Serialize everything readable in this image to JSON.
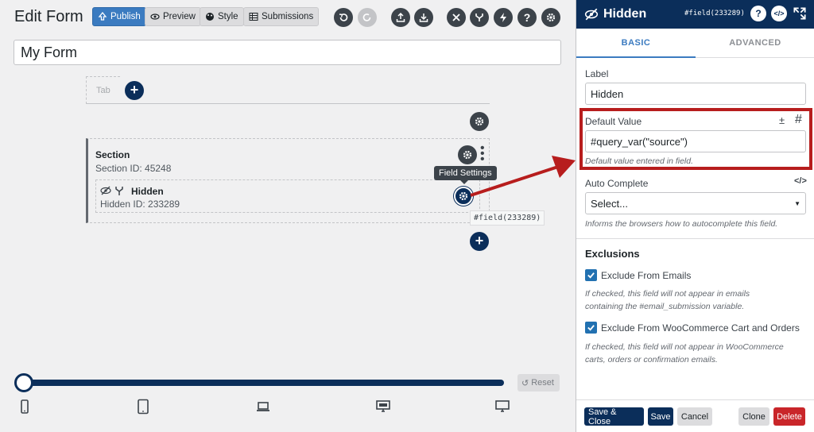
{
  "header": {
    "title": "Edit Form",
    "buttons": {
      "publish": "Publish",
      "preview": "Preview",
      "style": "Style",
      "submissions": "Submissions"
    }
  },
  "form": {
    "name": "My Form",
    "tab_label": "Tab",
    "section": {
      "title": "Section",
      "id_text": "Section ID: 45248"
    },
    "field": {
      "title": "Hidden",
      "id_text": "Hidden ID: 233289",
      "tooltip": "Field Settings",
      "tag": "#field(233289)"
    }
  },
  "footer_left": {
    "reset": "Reset",
    "slider_value": 0
  },
  "panel": {
    "title": "Hidden",
    "tag": "#field(233289)",
    "tabs": [
      "BASIC",
      "ADVANCED"
    ],
    "label": {
      "label": "Label",
      "value": "Hidden"
    },
    "default_value": {
      "label": "Default Value",
      "value": "#query_var(\"source\")",
      "help": "Default value entered in field."
    },
    "autocomplete": {
      "label": "Auto Complete",
      "value": "Select...",
      "help": "Informs the browsers how to autocomplete this field."
    },
    "exclusions": {
      "heading": "Exclusions",
      "emails_label": "Exclude From Emails",
      "emails_help_1": "If checked, this field will not appear in emails",
      "emails_help_2": "containing the #email_submission variable.",
      "woo_label": "Exclude From WooCommerce Cart and Orders",
      "woo_help_1": "If checked, this field will not appear in WooCommerce",
      "woo_help_2": "carts, orders or confirmation emails."
    },
    "footer": {
      "save_close": "Save & Close",
      "save": "Save",
      "cancel": "Cancel",
      "clone": "Clone",
      "delete": "Delete"
    }
  },
  "colors": {
    "navy": "#0b2e5a",
    "highlight_red": "#b71d1d",
    "primary_blue": "#3b7bc0"
  }
}
